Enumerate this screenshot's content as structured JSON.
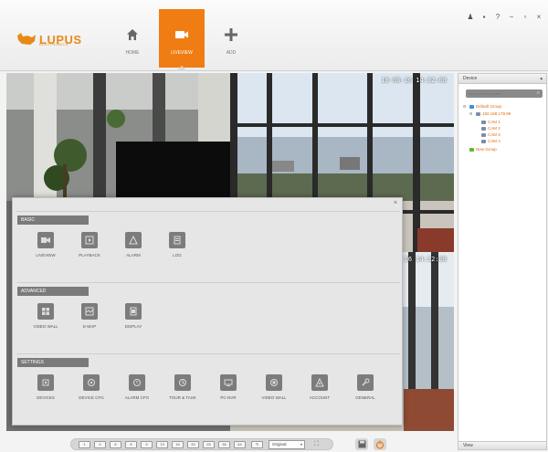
{
  "brand": {
    "name": "LUPUS",
    "tagline": "ELECTRONICS",
    "color": "#e88a18"
  },
  "nav": {
    "items": [
      {
        "label": "HOME",
        "icon": "home-icon",
        "active": false
      },
      {
        "label": "LIVEVIEW",
        "icon": "camera-icon",
        "active": true
      },
      {
        "label": "ADD",
        "icon": "plus-icon",
        "active": false
      }
    ],
    "active_color": "#f07d13"
  },
  "window_controls": {
    "user": "♟",
    "lock": "🔒",
    "help": "?",
    "minimize": "−",
    "maximize": "▫",
    "close": "×"
  },
  "cameras": [
    {
      "timestamp": "18-06-16 14:32:08"
    },
    {
      "timestamp": "18-06-16 14:32:08"
    }
  ],
  "menu": {
    "close": "×",
    "sections": [
      {
        "title": "BASIC",
        "items": [
          {
            "label": "LIVEVIEW",
            "icon": "liveview-icon"
          },
          {
            "label": "PLAYBACK",
            "icon": "playback-icon"
          },
          {
            "label": "ALARM",
            "icon": "alarm-icon"
          },
          {
            "label": "LOG",
            "icon": "log-icon"
          }
        ]
      },
      {
        "title": "ADVANCED",
        "items": [
          {
            "label": "VIDEO WALL",
            "icon": "video-wall-icon"
          },
          {
            "label": "E-MAP",
            "icon": "e-map-icon"
          },
          {
            "label": "DISPLAY",
            "icon": "display-icon"
          }
        ]
      },
      {
        "title": "SETTINGS",
        "items": [
          {
            "label": "DEVICES",
            "icon": "devices-icon"
          },
          {
            "label": "DEVICE CFG",
            "icon": "device-cfg-icon"
          },
          {
            "label": "ALARM CFG",
            "icon": "alarm-cfg-icon"
          },
          {
            "label": "TOUR & TASK",
            "icon": "tour-task-icon"
          },
          {
            "label": "PC-NVR",
            "icon": "pc-nvr-icon"
          },
          {
            "label": "VIDEO WALL",
            "icon": "video-wall-cfg-icon"
          },
          {
            "label": "ACCOUNT",
            "icon": "account-icon"
          },
          {
            "label": "GENERAL",
            "icon": "general-icon"
          }
        ]
      }
    ]
  },
  "sidebar": {
    "header": "Device",
    "search_placeholder": "Input search content",
    "tree": {
      "group": "Default Group",
      "device": "192.168.178.99",
      "cameras": [
        "CAM 1",
        "CAM 2",
        "CAM 3",
        "CAM 4"
      ],
      "new_group": "New Group"
    },
    "footer": "View"
  },
  "toolbar": {
    "layout_buttons": [
      "1",
      "4",
      "6",
      "8",
      "9",
      "13",
      "16",
      "20",
      "25",
      "36",
      "64"
    ],
    "stream": "Original",
    "fullscreen": "⛶"
  }
}
